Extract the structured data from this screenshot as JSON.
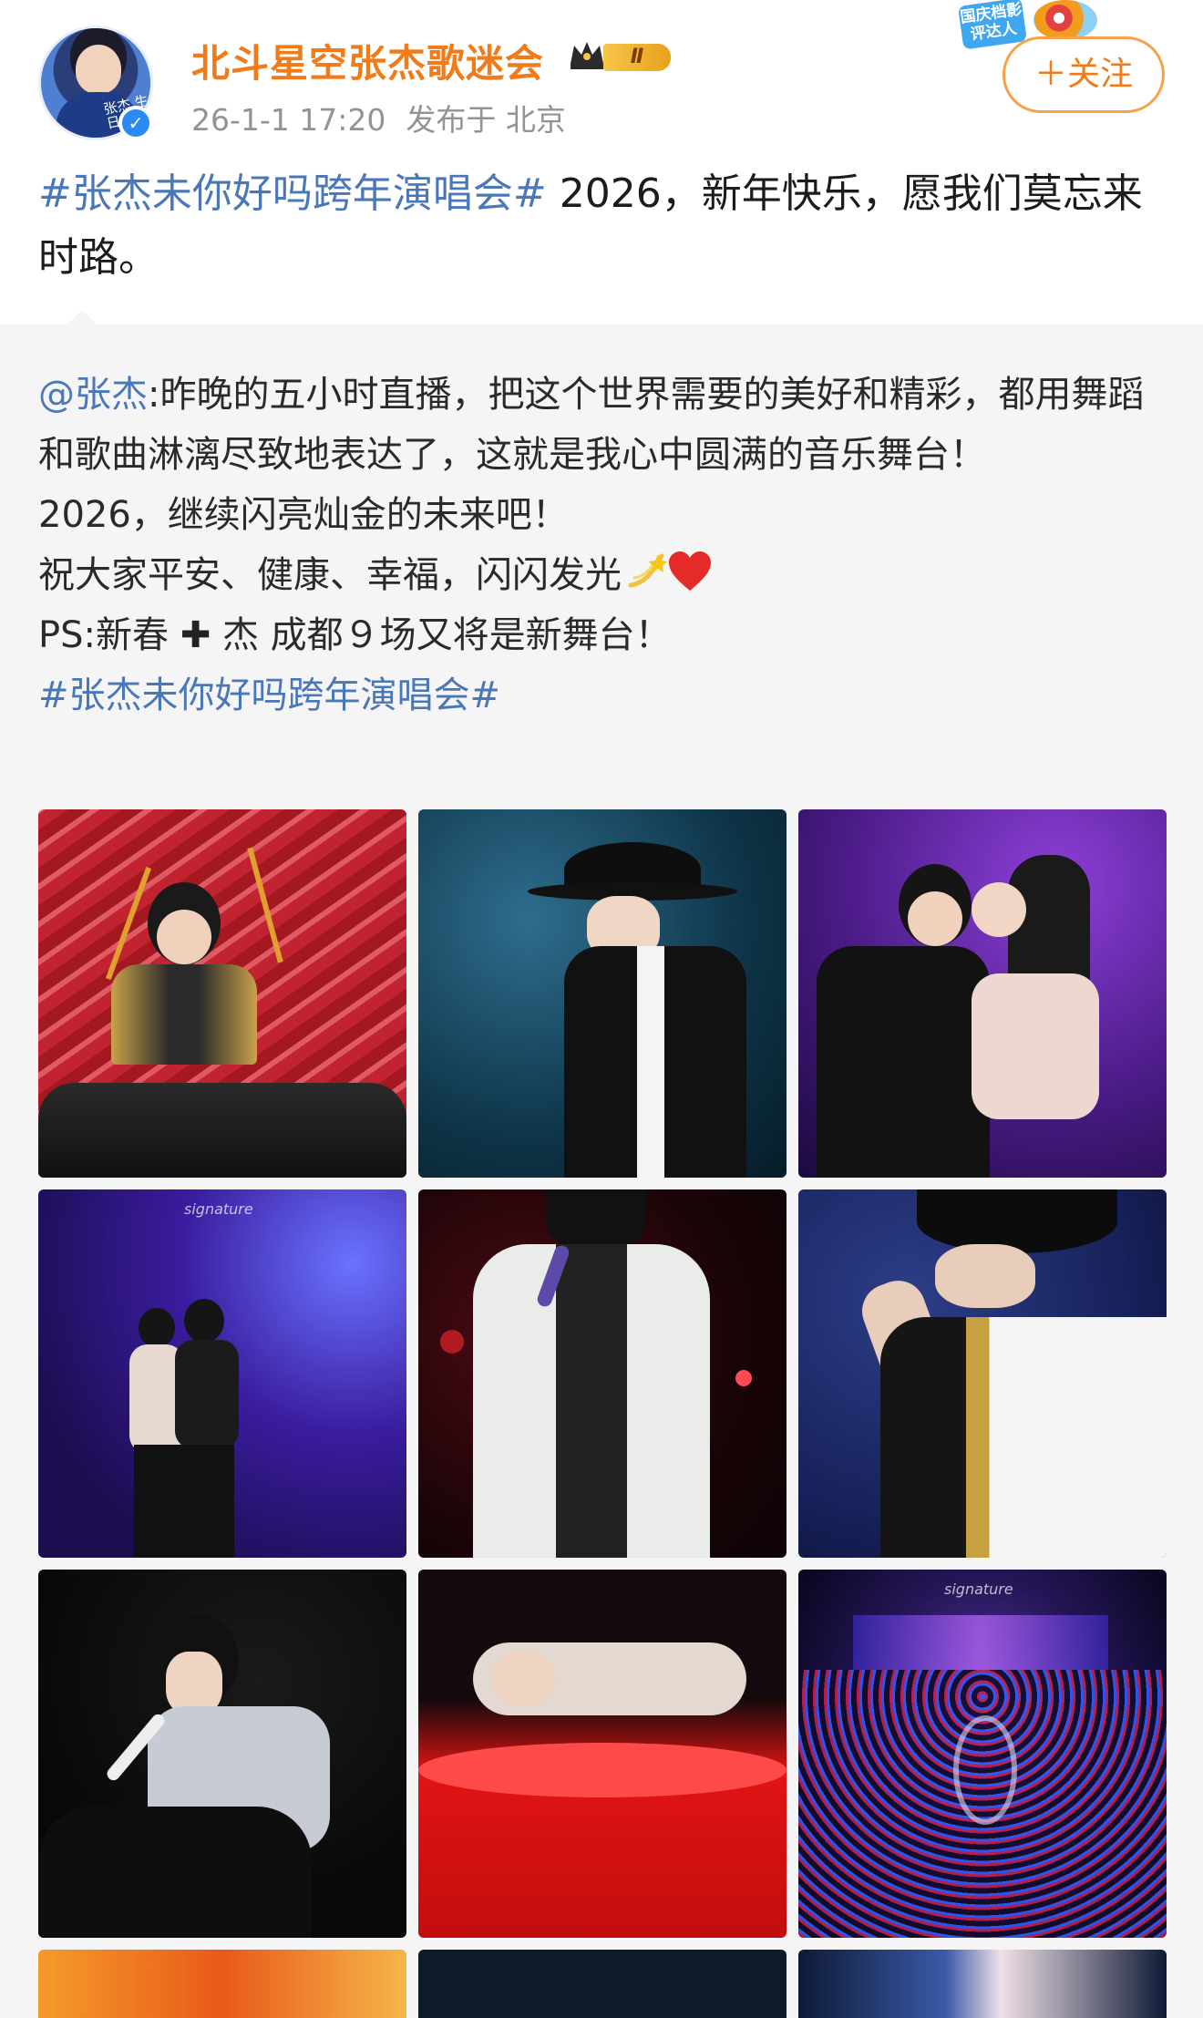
{
  "post": {
    "username": "北斗星空张杰歌迷会",
    "level_badge": "Ⅱ",
    "timestamp": "26-1-1 17:20",
    "location": "发布于 北京",
    "follow_label": "＋关注",
    "promo_label": "国庆档影评达人",
    "avatar_text": "张杰 生日快乐",
    "hashtag": "#张杰未你好吗跨年演唱会#",
    "body_text": " 2026，新年快乐，愿我们莫忘来时路。"
  },
  "repost": {
    "mention": "@张杰",
    "line1": ":昨晚的五小时直播，把这个世界需要的美好和精彩，都用舞蹈和歌曲淋漓尽致地表达了，这就是我心中圆满的音乐舞台！",
    "line2": "2026，继续闪亮灿金的未来吧！",
    "line3": "祝大家平安、健康、幸福，闪闪发光",
    "line4_a": "PS:新春",
    "line4_b": " 杰 成都９场又将是新舞台！",
    "hashtag": "#张杰未你好吗跨年演唱会#"
  },
  "photos": [
    {
      "name": "drummer-photo"
    },
    {
      "name": "hat-pose-photo"
    },
    {
      "name": "duet-embrace-photo"
    },
    {
      "name": "dance-duet-photo"
    },
    {
      "name": "white-coat-singing-photo"
    },
    {
      "name": "hat-closeup-photo"
    },
    {
      "name": "seated-singing-photo"
    },
    {
      "name": "lying-red-bed-photo"
    },
    {
      "name": "arena-stage-photo"
    }
  ],
  "colors": {
    "username": "#f07b1a",
    "hashtag": "#4a77b8",
    "verified": "#2b8bf2",
    "repost_bg": "#f5f5f5"
  }
}
